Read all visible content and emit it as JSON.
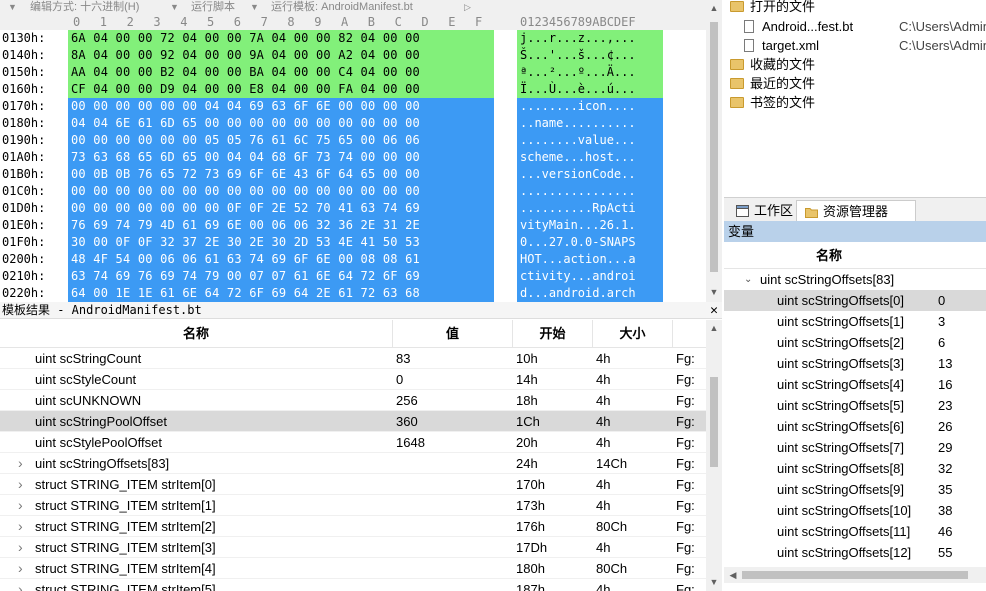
{
  "hex_editor": {
    "menu": [
      {
        "id": "edit-mode",
        "label": "编辑方式: 十六进制(H)"
      },
      {
        "id": "run-script",
        "label": "运行脚本"
      },
      {
        "id": "run-template",
        "label": "运行模板: AndroidManifest.bt"
      }
    ],
    "ruler": [
      "0",
      "1",
      "2",
      "3",
      "4",
      "5",
      "6",
      "7",
      "8",
      "9",
      "A",
      "B",
      "C",
      "D",
      "E",
      "F"
    ],
    "ascii_ruler": "0123456789ABCDEF",
    "rows": [
      {
        "addr": "0130h:",
        "bytes": "6A 04 00 00 72 04 00 00 7A 04 00 00 82 04 00 00",
        "ascii": "j...r...z...‚...",
        "color": "green"
      },
      {
        "addr": "0140h:",
        "bytes": "8A 04 00 00 92 04 00 00 9A 04 00 00 A2 04 00 00",
        "ascii": "Š...'...š...¢...",
        "color": "green"
      },
      {
        "addr": "0150h:",
        "bytes": "AA 04 00 00 B2 04 00 00 BA 04 00 00 C4 04 00 00",
        "ascii": "ª...²...º...Ä...",
        "color": "green"
      },
      {
        "addr": "0160h:",
        "bytes": "CF 04 00 00 D9 04 00 00 E8 04 00 00 FA 04 00 00",
        "ascii": "Ï...Ù...è...ú...",
        "color": "green"
      },
      {
        "addr": "0170h:",
        "bytes": "00 00 00 00 00 00 04 04 69 63 6F 6E 00 00 00 00",
        "ascii": "........icon....",
        "color": "blue"
      },
      {
        "addr": "0180h:",
        "bytes": "04 04 6E 61 6D 65 00 00 00 00 00 00 00 00 00 00",
        "ascii": "..name..........",
        "color": "blue"
      },
      {
        "addr": "0190h:",
        "bytes": "00 00 00 00 00 00 05 05 76 61 6C 75 65 00 06 06",
        "ascii": "........value...",
        "color": "blue"
      },
      {
        "addr": "01A0h:",
        "bytes": "73 63 68 65 6D 65 00 04 04 68 6F 73 74 00 00 00",
        "ascii": "scheme...host...",
        "color": "blue"
      },
      {
        "addr": "01B0h:",
        "bytes": "00 0B 0B 76 65 72 73 69 6F 6E 43 6F 64 65 00 00",
        "ascii": "...versionCode..",
        "color": "blue"
      },
      {
        "addr": "01C0h:",
        "bytes": "00 00 00 00 00 00 00 00 00 00 00 00 00 00 00 00",
        "ascii": "................",
        "color": "blue"
      },
      {
        "addr": "01D0h:",
        "bytes": "00 00 00 00 00 00 00 0F 0F 2E 52 70 41 63 74 69",
        "ascii": "..........RpActi",
        "color": "blue"
      },
      {
        "addr": "01E0h:",
        "bytes": "76 69 74 79 4D 61 69 6E 00 06 06 32 36 2E 31 2E",
        "ascii": "vityMain...26.1.",
        "color": "blue"
      },
      {
        "addr": "01F0h:",
        "bytes": "30 00 0F 0F 32 37 2E 30 2E 30 2D 53 4E 41 50 53",
        "ascii": "0...27.0.0-SNAPS",
        "color": "blue"
      },
      {
        "addr": "0200h:",
        "bytes": "48 4F 54 00 06 06 61 63 74 69 6F 6E 00 08 08 61",
        "ascii": "HOT...action...a",
        "color": "blue"
      },
      {
        "addr": "0210h:",
        "bytes": "63 74 69 76 69 74 79 00 07 07 61 6E 64 72 6F 69",
        "ascii": "ctivity...androi",
        "color": "blue"
      },
      {
        "addr": "0220h:",
        "bytes": "64 00 1E 1E 61 6E 64 72 6F 69 64 2E 61 72 63 68",
        "ascii": "d...android.arch",
        "color": "blue"
      }
    ]
  },
  "template_results": {
    "title": "模板结果 - AndroidManifest.bt",
    "columns": [
      "名称",
      "值",
      "开始",
      "大小",
      ""
    ],
    "rows": [
      {
        "name": "uint scStringCount",
        "value": "83",
        "start": "10h",
        "size": "4h",
        "color": "Fg:",
        "expandable": false,
        "selected": false
      },
      {
        "name": "uint scStyleCount",
        "value": "0",
        "start": "14h",
        "size": "4h",
        "color": "Fg:",
        "expandable": false,
        "selected": false
      },
      {
        "name": "uint scUNKNOWN",
        "value": "256",
        "start": "18h",
        "size": "4h",
        "color": "Fg:",
        "expandable": false,
        "selected": false
      },
      {
        "name": "uint scStringPoolOffset",
        "value": "360",
        "start": "1Ch",
        "size": "4h",
        "color": "Fg:",
        "expandable": false,
        "selected": true
      },
      {
        "name": "uint scStylePoolOffset",
        "value": "1648",
        "start": "20h",
        "size": "4h",
        "color": "Fg:",
        "expandable": false,
        "selected": false
      },
      {
        "name": "uint scStringOffsets[83]",
        "value": "",
        "start": "24h",
        "size": "14Ch",
        "color": "Fg:",
        "expandable": true,
        "selected": false
      },
      {
        "name": "struct STRING_ITEM strItem[0]",
        "value": "",
        "start": "170h",
        "size": "4h",
        "color": "Fg:",
        "expandable": true,
        "selected": false
      },
      {
        "name": "struct STRING_ITEM strItem[1]",
        "value": "",
        "start": "173h",
        "size": "4h",
        "color": "Fg:",
        "expandable": true,
        "selected": false
      },
      {
        "name": "struct STRING_ITEM strItem[2]",
        "value": "",
        "start": "176h",
        "size": "80Ch",
        "color": "Fg:",
        "expandable": true,
        "selected": false
      },
      {
        "name": "struct STRING_ITEM strItem[3]",
        "value": "",
        "start": "17Dh",
        "size": "4h",
        "color": "Fg:",
        "expandable": true,
        "selected": false
      },
      {
        "name": "struct STRING_ITEM strItem[4]",
        "value": "",
        "start": "180h",
        "size": "80Ch",
        "color": "Fg:",
        "expandable": true,
        "selected": false
      },
      {
        "name": "struct STRING_ITEM strItem[5]",
        "value": "",
        "start": "187h",
        "size": "4h",
        "color": "Fg:",
        "expandable": true,
        "selected": false
      }
    ]
  },
  "files": {
    "items": [
      {
        "type": "folder",
        "label": "打开的文件",
        "path": ""
      },
      {
        "type": "doc",
        "label": "Android...fest.bt",
        "path": "C:\\Users\\Administ"
      },
      {
        "type": "doc",
        "label": "target.xml",
        "path": "C:\\Users\\Administ"
      },
      {
        "type": "folder",
        "label": "收藏的文件",
        "path": ""
      },
      {
        "type": "folder",
        "label": "最近的文件",
        "path": ""
      },
      {
        "type": "folder",
        "label": "书签的文件",
        "path": ""
      }
    ]
  },
  "tabs": {
    "workspace": "工作区",
    "explorer": "资源管理器"
  },
  "variables": {
    "header": "变量",
    "col_name": "名称",
    "group": "uint scStringOffsets[83]",
    "items": [
      {
        "name": "uint scStringOffsets[0]",
        "value": "0",
        "selected": true
      },
      {
        "name": "uint scStringOffsets[1]",
        "value": "3",
        "selected": false
      },
      {
        "name": "uint scStringOffsets[2]",
        "value": "6",
        "selected": false
      },
      {
        "name": "uint scStringOffsets[3]",
        "value": "13",
        "selected": false
      },
      {
        "name": "uint scStringOffsets[4]",
        "value": "16",
        "selected": false
      },
      {
        "name": "uint scStringOffsets[5]",
        "value": "23",
        "selected": false
      },
      {
        "name": "uint scStringOffsets[6]",
        "value": "26",
        "selected": false
      },
      {
        "name": "uint scStringOffsets[7]",
        "value": "29",
        "selected": false
      },
      {
        "name": "uint scStringOffsets[8]",
        "value": "32",
        "selected": false
      },
      {
        "name": "uint scStringOffsets[9]",
        "value": "35",
        "selected": false
      },
      {
        "name": "uint scStringOffsets[10]",
        "value": "38",
        "selected": false
      },
      {
        "name": "uint scStringOffsets[11]",
        "value": "46",
        "selected": false
      },
      {
        "name": "uint scStringOffsets[12]",
        "value": "55",
        "selected": false
      }
    ]
  },
  "colors": {
    "green": "#82f07a",
    "blue": "#3c9af4",
    "selected_row": "#d9d9d9",
    "var_header": "#b9d1ea"
  }
}
